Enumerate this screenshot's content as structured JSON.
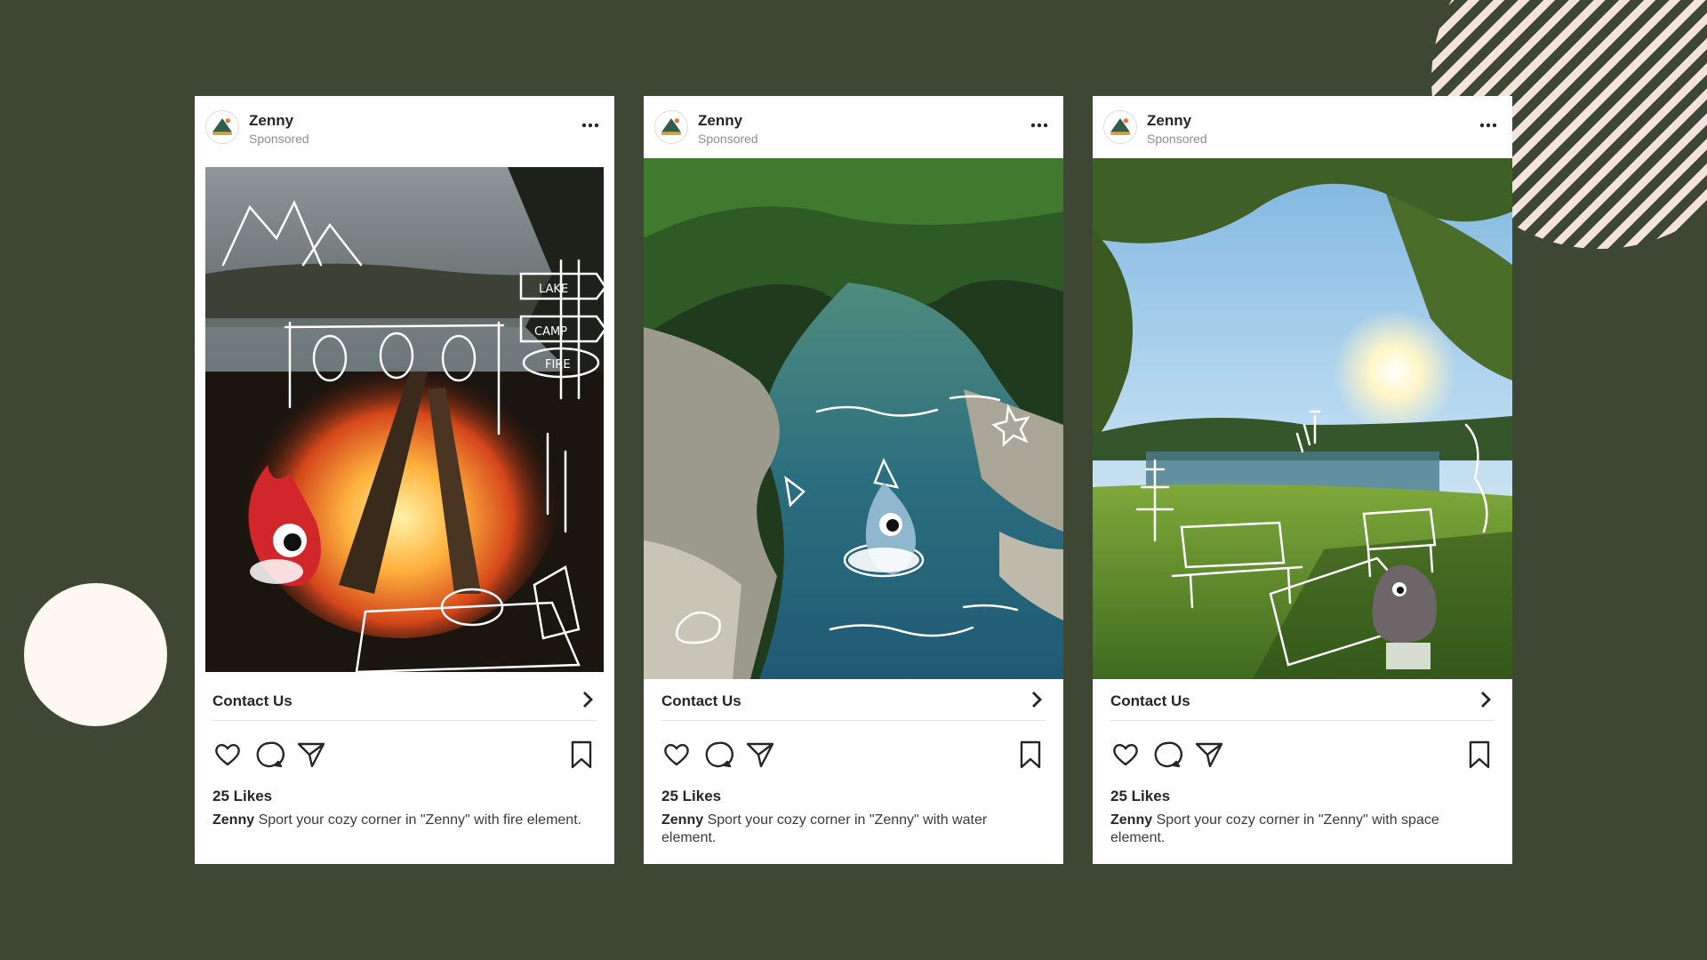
{
  "colors": {
    "background": "#3d4734",
    "card": "#ffffff",
    "stripes": "#f3e3dc",
    "cream_circle": "#fdf8f1",
    "text_primary": "#262626",
    "text_secondary": "#8e8e8e"
  },
  "posts": [
    {
      "account": "Zenny",
      "label": "Sponsored",
      "image_theme": "campfire at a lake with doodle drawings",
      "cta": "Contact Us",
      "likes": "25 Likes",
      "caption_user": "Zenny",
      "caption_text": "Sport your cozy corner in \"Zenny\" with fire element."
    },
    {
      "account": "Zenny",
      "label": "Sponsored",
      "image_theme": "river through a forest with doodle drawings",
      "cta": "Contact Us",
      "likes": "25 Likes",
      "caption_user": "Zenny",
      "caption_text": "Sport your cozy corner in \"Zenny\" with water element."
    },
    {
      "account": "Zenny",
      "label": "Sponsored",
      "image_theme": "sunny park with bench and picnic doodles",
      "cta": "Contact Us",
      "likes": "25 Likes",
      "caption_user": "Zenny",
      "caption_text": "Sport your cozy corner in \"Zenny\" with space element."
    }
  ],
  "icons": [
    "more-icon",
    "chevron-right-icon",
    "heart-icon",
    "comment-icon",
    "share-icon",
    "bookmark-icon"
  ]
}
